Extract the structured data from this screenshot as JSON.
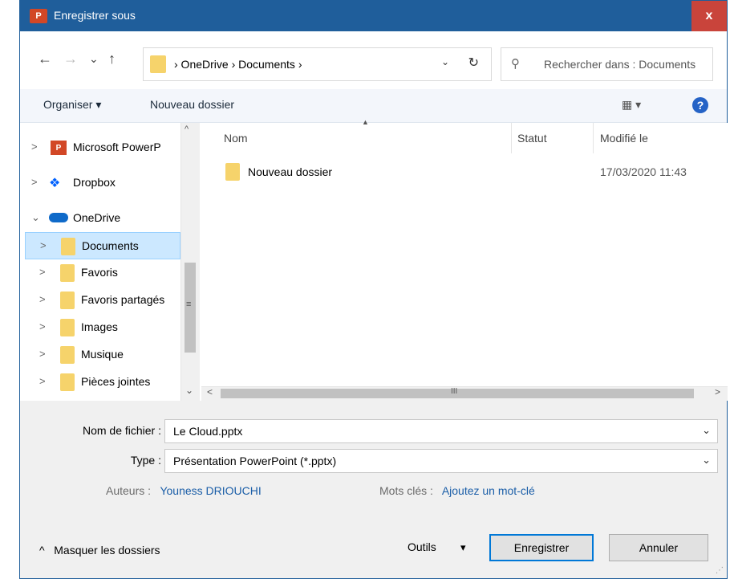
{
  "window": {
    "title": "Enregistrer sous",
    "app_icon": "P",
    "close_label": "x"
  },
  "nav": {
    "back_icon": "←",
    "forward_icon": "→",
    "recent_icon": "⌄",
    "up_icon": "↑",
    "address_path": "›  OneDrive  ›  Documents  ›",
    "address_chevron": "⌄",
    "refresh_icon": "↻",
    "search_placeholder": "Rechercher dans : Documents"
  },
  "toolbar": {
    "organize_label": "Organiser ▾",
    "new_folder_label": "Nouveau dossier",
    "view_label": "▦ ▾",
    "help_label": "?"
  },
  "tree": [
    {
      "label": "Microsoft PowerP",
      "icon": "powerpoint-icon",
      "arrow": ">"
    },
    {
      "label": "Dropbox",
      "icon": "dropbox-icon",
      "arrow": ">"
    },
    {
      "label": "OneDrive",
      "icon": "onedrive-icon",
      "arrow": "⌄"
    },
    {
      "label": "Documents",
      "icon": "folder-icon",
      "arrow": ">",
      "selected": true
    },
    {
      "label": "Favoris",
      "icon": "folder-icon",
      "arrow": ">"
    },
    {
      "label": "Favoris partagés",
      "icon": "folder-icon",
      "arrow": ">"
    },
    {
      "label": "Images",
      "icon": "folder-icon",
      "arrow": ">"
    },
    {
      "label": "Musique",
      "icon": "folder-icon",
      "arrow": ">"
    },
    {
      "label": "Pièces jointes",
      "icon": "folder-icon",
      "arrow": ">"
    }
  ],
  "columns": {
    "name": "Nom",
    "status": "Statut",
    "modified": "Modifié le"
  },
  "files": [
    {
      "name": "Nouveau dossier",
      "modified": "17/03/2020 11:43"
    }
  ],
  "scrollbars": {
    "up": "^",
    "down": "⌄",
    "grip": "≡",
    "left": "<",
    "right": ">",
    "hgrip": "III"
  },
  "form": {
    "filename_label": "Nom de fichier :",
    "filename_value": "Le Cloud.pptx",
    "type_label": "Type :",
    "type_value": "Présentation PowerPoint (*.pptx)",
    "authors_label": "Auteurs :",
    "authors_value": "Youness DRIOUCHI",
    "tags_label": "Mots clés :",
    "tags_value": "Ajoutez un mot-clé"
  },
  "footer": {
    "hide_folders": "Masquer les dossiers",
    "tools": "Outils",
    "save": "Enregistrer",
    "cancel": "Annuler"
  }
}
